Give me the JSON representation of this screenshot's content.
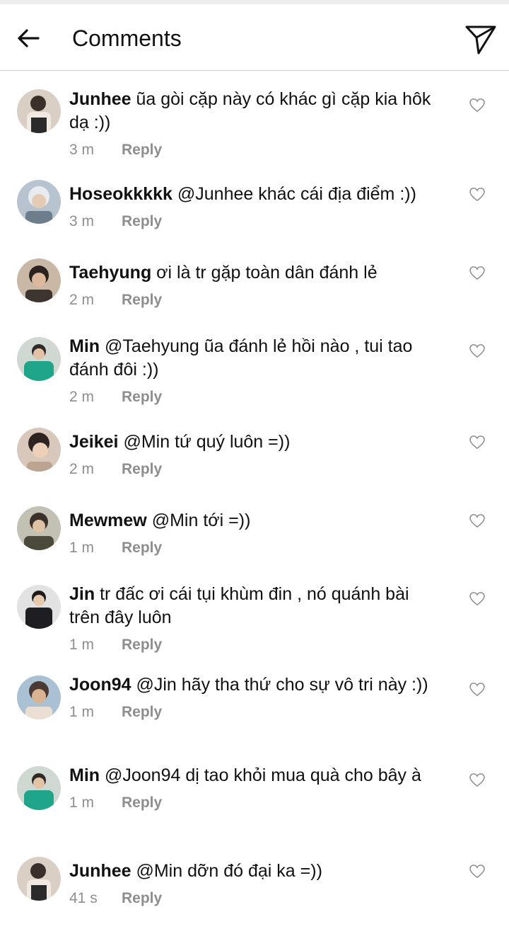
{
  "header": {
    "title": "Comments"
  },
  "comments": [
    {
      "user": "Junhee",
      "text": " ũa gòi cặp này có khác gì cặp kia hôk dạ :))",
      "time": "3 m",
      "reply": "Reply"
    },
    {
      "user": "Hoseokkkkk",
      "text": " @Junhee khác cái địa điểm :))",
      "time": "3 m",
      "reply": "Reply"
    },
    {
      "user": "Taehyung",
      "text": " ơi là tr gặp toàn dân đánh lẻ",
      "time": "2 m",
      "reply": "Reply"
    },
    {
      "user": "Min",
      "text": " @Taehyung ũa đánh lẻ hồi nào , tui tao đánh đôi :))",
      "time": "2 m",
      "reply": "Reply"
    },
    {
      "user": "Jeikei",
      "text": " @Min tứ quý luôn =))",
      "time": "2 m",
      "reply": "Reply"
    },
    {
      "user": "Mewmew",
      "text": " @Min tới =))",
      "time": "1 m",
      "reply": "Reply"
    },
    {
      "user": "Jin",
      "text": " tr đấc ơi cái tụi khùm đin , nó quánh bài trên đây luôn",
      "time": "1 m",
      "reply": "Reply"
    },
    {
      "user": "Joon94",
      "text": " @Jin hãy tha thứ cho sự vô tri này :))",
      "time": "1 m",
      "reply": "Reply"
    },
    {
      "user": "Min",
      "text": " @Joon94 dị tao khỏi mua quà cho bây à",
      "time": "1 m",
      "reply": "Reply"
    },
    {
      "user": "Junhee",
      "text": " @Min dỡn đó đại ka =))",
      "time": "41 s",
      "reply": "Reply"
    }
  ]
}
